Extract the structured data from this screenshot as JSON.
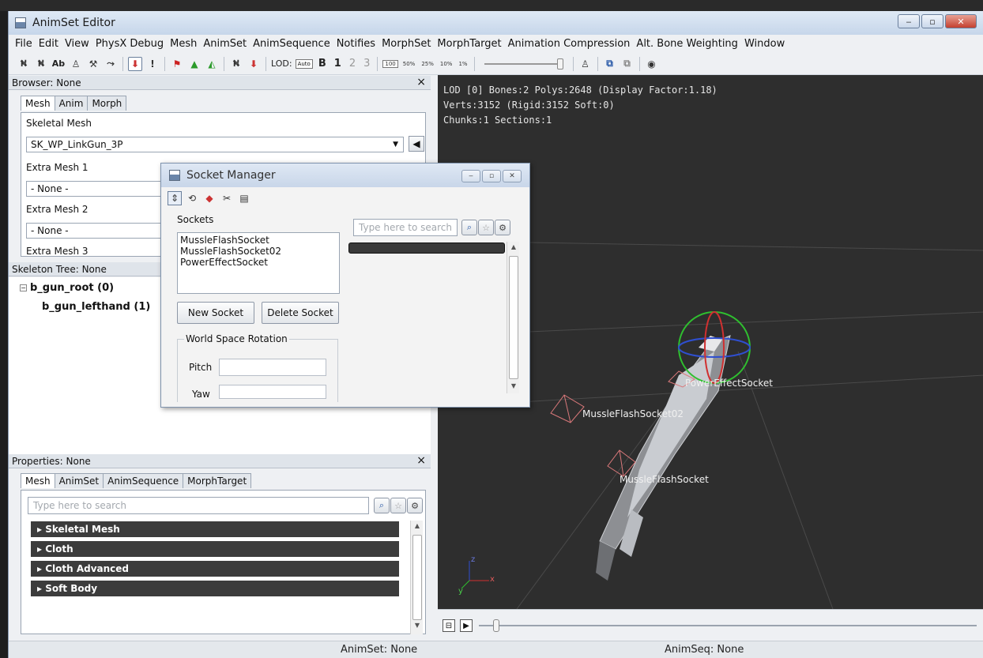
{
  "window": {
    "title": "AnimSet Editor",
    "buttons": {
      "minimize": "‒",
      "maximize": "▫",
      "close": "✕"
    }
  },
  "menu": [
    "File",
    "Edit",
    "View",
    "PhysX Debug",
    "Mesh",
    "AnimSet",
    "AnimSequence",
    "Notifies",
    "MorphSet",
    "MorphTarget",
    "Animation Compression",
    "Alt. Bone Weighting",
    "Window"
  ],
  "toolbar": {
    "ab_label": "Ab",
    "lod_label": "LOD:",
    "lod_auto": "Auto",
    "lod_base": "B",
    "lod_levels": [
      "1",
      "2",
      "3"
    ],
    "percents": [
      "100",
      "50%",
      "25%",
      "10%",
      "1%"
    ]
  },
  "browser": {
    "header": "Browser: None",
    "close": "×",
    "tabs": [
      "Mesh",
      "Anim",
      "Morph"
    ],
    "skeletal_mesh_label": "Skeletal Mesh",
    "skeletal_mesh_value": "SK_WP_LinkGun_3P",
    "extra_mesh_1_label": "Extra Mesh 1",
    "extra_mesh_1_value": "- None -",
    "extra_mesh_2_label": "Extra Mesh 2",
    "extra_mesh_2_value": "- None -",
    "extra_mesh_3_label": "Extra Mesh 3"
  },
  "skeleton": {
    "header": "Skeleton Tree: None",
    "nodes": [
      "b_gun_root (0)",
      "b_gun_lefthand (1)"
    ]
  },
  "properties": {
    "header": "Properties: None",
    "close": "×",
    "tabs": [
      "Mesh",
      "AnimSet",
      "AnimSequence",
      "MorphTarget"
    ],
    "search_placeholder": "Type here to search",
    "categories": [
      "Skeletal Mesh",
      "Cloth",
      "Cloth Advanced",
      "Soft Body"
    ]
  },
  "viewport": {
    "info": [
      "LOD [0] Bones:2 Polys:2648 (Display Factor:1.18)",
      "Verts:3152 (Rigid:3152 Soft:0)",
      "Chunks:1 Sections:1"
    ],
    "socket_labels": [
      "PowerEffectSocket",
      "MussleFlashSocket02",
      "MussleFlashSocket"
    ],
    "axis_z": "z",
    "axis_x": "x",
    "axis_y": "y"
  },
  "status": {
    "animset": "AnimSet: None",
    "animseq": "AnimSeq: None"
  },
  "socket_manager": {
    "title": "Socket Manager",
    "sockets_label": "Sockets",
    "sockets": [
      "MussleFlashSocket",
      "MussleFlashSocket02",
      "PowerEffectSocket"
    ],
    "search_placeholder": "Type here to search",
    "new_socket": "New Socket",
    "delete_socket": "Delete Socket",
    "rotation_group": "World Space Rotation",
    "pitch_label": "Pitch",
    "yaw_label": "Yaw"
  },
  "colors": {
    "viewport_bg": "#2e2e2e",
    "socket_label": "#f0f0f0",
    "socket_marker": "#d9787a"
  }
}
